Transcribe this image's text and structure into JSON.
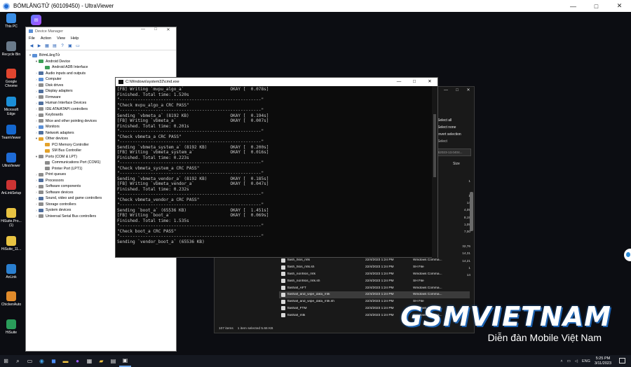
{
  "window": {
    "title": "BÓMLĂNGTỬ (60109450) - UltraViewer",
    "controls": [
      "—",
      "□",
      "✕"
    ]
  },
  "desktop_icons": [
    {
      "label": "This PC",
      "icon": "pc-icon",
      "color": "#3a8ee6"
    },
    {
      "label": "Recycle Bin",
      "icon": "recycle-bin-icon",
      "color": "#6a7a8a"
    },
    {
      "label": "Google\nChrome",
      "icon": "chrome-icon",
      "color": "#e0452f"
    },
    {
      "label": "Microsoft\nEdge",
      "icon": "edge-icon",
      "color": "#1b8fd8"
    },
    {
      "label": "TeamViewer",
      "icon": "teamviewer-icon",
      "color": "#1467cf"
    },
    {
      "label": "UltraViewer",
      "icon": "ultraviewer-icon",
      "color": "#1e6bd6"
    },
    {
      "label": "AnLinkSetup",
      "icon": "anlink-setup-icon",
      "color": "#c33"
    },
    {
      "label": "HiSuite.Pro...\n(1)",
      "icon": "hisuite-pro-icon",
      "color": "#e8c342"
    },
    {
      "label": "HiSuite_11...",
      "icon": "hisuite-archive-icon",
      "color": "#e8c342"
    },
    {
      "label": "AnLink",
      "icon": "anlink-icon",
      "color": "#2a7fd0"
    },
    {
      "label": "ChickenAuto",
      "icon": "chicken-auto-icon",
      "color": "#e08a2a"
    },
    {
      "label": "HiSuite",
      "icon": "hisuite-icon",
      "color": "#2a9d5a"
    }
  ],
  "device_manager": {
    "title": "Device Manager",
    "menu": [
      "File",
      "Action",
      "View",
      "Help"
    ],
    "tree": [
      {
        "label": "BớmLăngTử",
        "level": 0,
        "expander": "▾",
        "icon": "ico-pc"
      },
      {
        "label": "Android Device",
        "level": 1,
        "expander": "▾",
        "icon": "ico-green"
      },
      {
        "label": "Android ADB Interface",
        "level": 2,
        "expander": "",
        "icon": "ico-green"
      },
      {
        "label": "Audio inputs and outputs",
        "level": 1,
        "expander": "›",
        "icon": "ico-dev"
      },
      {
        "label": "Computer",
        "level": 1,
        "expander": "›",
        "icon": "ico-pc"
      },
      {
        "label": "Disk drives",
        "level": 1,
        "expander": "›",
        "icon": "ico-gray"
      },
      {
        "label": "Display adapters",
        "level": 1,
        "expander": "›",
        "icon": "ico-dev"
      },
      {
        "label": "Firmware",
        "level": 1,
        "expander": "›",
        "icon": "ico-gray"
      },
      {
        "label": "Human Interface Devices",
        "level": 1,
        "expander": "›",
        "icon": "ico-dev"
      },
      {
        "label": "IDE ATA/ATAPI controllers",
        "level": 1,
        "expander": "›",
        "icon": "ico-gray"
      },
      {
        "label": "Keyboards",
        "level": 1,
        "expander": "›",
        "icon": "ico-gray"
      },
      {
        "label": "Mice and other pointing devices",
        "level": 1,
        "expander": "›",
        "icon": "ico-gray"
      },
      {
        "label": "Monitors",
        "level": 1,
        "expander": "›",
        "icon": "ico-pc"
      },
      {
        "label": "Network adapters",
        "level": 1,
        "expander": "›",
        "icon": "ico-dev"
      },
      {
        "label": "Other devices",
        "level": 1,
        "expander": "▾",
        "icon": "ico-warn"
      },
      {
        "label": "PCI Memory Controller",
        "level": 2,
        "expander": "",
        "icon": "ico-warn"
      },
      {
        "label": "SM Bus Controller",
        "level": 2,
        "expander": "",
        "icon": "ico-warn"
      },
      {
        "label": "Ports (COM & LPT)",
        "level": 1,
        "expander": "▾",
        "icon": "ico-gray"
      },
      {
        "label": "Communications Port (COM1)",
        "level": 2,
        "expander": "",
        "icon": "ico-gray"
      },
      {
        "label": "Printer Port (LPT1)",
        "level": 2,
        "expander": "",
        "icon": "ico-gray"
      },
      {
        "label": "Print queues",
        "level": 1,
        "expander": "›",
        "icon": "ico-gray"
      },
      {
        "label": "Processors",
        "level": 1,
        "expander": "›",
        "icon": "ico-dev"
      },
      {
        "label": "Software components",
        "level": 1,
        "expander": "›",
        "icon": "ico-gray"
      },
      {
        "label": "Software devices",
        "level": 1,
        "expander": "›",
        "icon": "ico-gray"
      },
      {
        "label": "Sound, video and game controllers",
        "level": 1,
        "expander": "›",
        "icon": "ico-dev"
      },
      {
        "label": "Storage controllers",
        "level": 1,
        "expander": "›",
        "icon": "ico-gray"
      },
      {
        "label": "System devices",
        "level": 1,
        "expander": "›",
        "icon": "ico-dev"
      },
      {
        "label": "Universal Serial Bus controllers",
        "level": 1,
        "expander": "›",
        "icon": "ico-gray"
      }
    ]
  },
  "cmd": {
    "title": "C:\\Windows\\system32\\cmd.exe",
    "lines": [
      "[FB] Writing `mvpu_algo_a`                  OKAY [  0.078s]",
      "Finished. Total time: 1.520s",
      "\"-------------------------------------------------------\"",
      "\"Check mvpu_algo_a CRC PASS\"",
      "\"-------------------------------------------------------\"",
      "Sending `vbmeta_a` (8192 KB)                OKAY [  0.194s]",
      "[FB] Writing `vbmeta_a`                     OKAY [  0.007s]",
      "Finished. Total time: 0.201s",
      "\"-------------------------------------------------------\"",
      "\"Check vbmeta_a CRC PASS\"",
      "\"-------------------------------------------------------\"",
      "Sending `vbmeta_system_a` (8192 KB)         OKAY [  0.200s]",
      "[FB] Writing `vbmeta_system_a`              OKAY [  0.016s]",
      "Finished. Total time: 0.223s",
      "\"-------------------------------------------------------\"",
      "\"Check vbmeta_system_a CRC PASS\"",
      "\"-------------------------------------------------------\"",
      "Sending `vbmeta_vendor_a` (8192 KB)         OKAY [  0.185s]",
      "[FB] Writing `vbmeta_vendor_a`              OKAY [  0.047s]",
      "Finished. Total time: 0.232s",
      "\"-------------------------------------------------------\"",
      "\"Check vbmeta_vendor_a CRC PASS\"",
      "\"-------------------------------------------------------\"",
      "Sending `boot_a` (65536 KB)                 OKAY [  1.451s]",
      "[FB] Writing `boot_a`                       OKAY [  0.069s]",
      "Finished. Total time: 1.535s",
      "\"-------------------------------------------------------\"",
      "\"Check boot_a CRC PASS\"",
      "\"-------------------------------------------------------\"",
      "Sending `vendor_boot_a` (65536 KB)"
    ]
  },
  "explorer": {
    "select_menu": [
      "Select all",
      "Select none",
      "Invert selection"
    ],
    "select_label": "Select",
    "path_fragment": "ti2023-13.0404...",
    "size_header": "Size",
    "sizes": [
      "",
      "1",
      "",
      "1",
      "14",
      "4,09",
      "8,19",
      "1,09",
      "7,00",
      "",
      "32,76",
      "14,31",
      "14,21",
      "1",
      "14"
    ],
    "files": [
      {
        "name": "flash_hlos_mtk",
        "date": "22/4/2023 1:24 PM",
        "type": "Windows Comma...",
        "selected": false
      },
      {
        "name": "flash_hlos_mtk.sh",
        "date": "22/4/2023 1:24 PM",
        "type": "SH File",
        "selected": false
      },
      {
        "name": "flash_nonhlos_mtk",
        "date": "22/4/2023 1:24 PM",
        "type": "Windows Comma...",
        "selected": false
      },
      {
        "name": "flash_nonhlos_mtk.sh",
        "date": "22/4/2023 1:24 PM",
        "type": "SH File",
        "selected": false
      },
      {
        "name": "flashall_AFT",
        "date": "22/4/2023 1:24 PM",
        "type": "Windows Comma...",
        "selected": false
      },
      {
        "name": "flashall_and_wipe_data_mtk",
        "date": "22/4/2023 1:24 PM",
        "type": "Windows Comma...",
        "selected": true
      },
      {
        "name": "flashall_and_wipe_data_mtk.sh",
        "date": "22/4/2023 1:24 PM",
        "type": "SH File",
        "selected": false
      },
      {
        "name": "flashall_FTM",
        "date": "22/4/2023 1:24 PM",
        "type": "Windows Comma...",
        "selected": false
      },
      {
        "name": "flashall_mtk",
        "date": "22/4/2023 1:24 PM",
        "type": "Windows Comma...",
        "selected": false
      }
    ],
    "status_items": "107 items",
    "status_selected": "1 item selected  5.66 KB"
  },
  "watermark": {
    "brand": "GSMVIETNAM",
    "tagline": "Diễn đàn Mobile Việt Nam"
  },
  "taskbar": {
    "language": "ENG",
    "time": "5:25 PM",
    "date": "3/11/2023"
  }
}
